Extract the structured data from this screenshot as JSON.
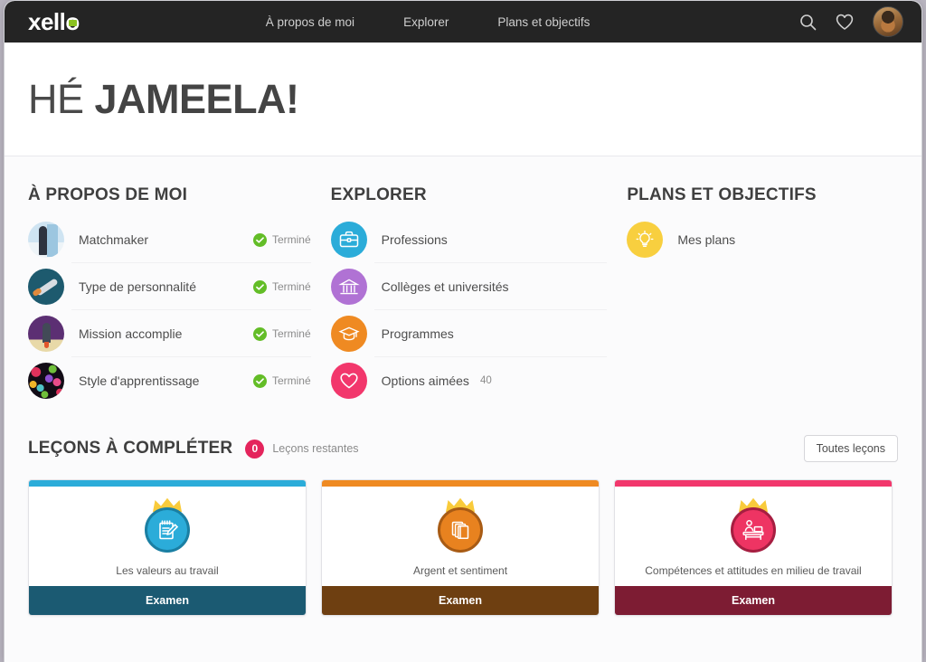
{
  "nav": {
    "logo_text": "xello",
    "links": [
      {
        "label": "À propos de moi"
      },
      {
        "label": "Explorer"
      },
      {
        "label": "Plans et objectifs"
      }
    ],
    "search_icon": "search-icon",
    "favourites_icon": "heart-icon",
    "avatar_icon": "user-avatar"
  },
  "hero": {
    "greeting": "HÉ",
    "name": "JAMEELA!"
  },
  "columns": [
    {
      "title": "À PROPOS DE MOI",
      "rows": [
        {
          "label": "Matchmaker",
          "status": "Terminé",
          "thumb": "rocket-launch-tower-icon"
        },
        {
          "label": "Type de personnalité",
          "status": "Terminé",
          "thumb": "rocket-flying-icon"
        },
        {
          "label": "Mission accomplie",
          "status": "Terminé",
          "thumb": "rocket-landed-icon"
        },
        {
          "label": "Style d'apprentissage",
          "status": "Terminé",
          "thumb": "confetti-icon"
        }
      ]
    },
    {
      "title": "EXPLORER",
      "rows": [
        {
          "label": "Professions",
          "count": "",
          "icon": "briefcase-icon",
          "color": "#2bacd9"
        },
        {
          "label": "Collèges et universités",
          "count": "",
          "icon": "bank-columns-icon",
          "color": "#b072d4"
        },
        {
          "label": "Programmes",
          "count": "",
          "icon": "graduation-cap-icon",
          "color": "#ef8a22"
        },
        {
          "label": "Options aimées",
          "count": "40",
          "icon": "heart-icon",
          "color": "#f2376c"
        }
      ]
    },
    {
      "title": "PLANS ET OBJECTIFS",
      "rows": [
        {
          "label": "Mes plans",
          "count": "",
          "icon": "lightbulb-icon",
          "color": "#f8cf3f"
        }
      ]
    }
  ],
  "lessons": {
    "title": "LEÇONS À COMPLÉTER",
    "badge_count": "0",
    "remaining_label": "Leçons restantes",
    "all_lessons_button": "Toutes leçons",
    "cards": [
      {
        "title": "Les valeurs au travail",
        "footer_label": "Examen",
        "icon": "notepad-pencil-icon",
        "top_color": "#2bacd9",
        "disc_color": "#2bacd9",
        "ring_color": "#1a7fa3",
        "foot_color": "#1b5a72"
      },
      {
        "title": "Argent et sentiment",
        "footer_label": "Examen",
        "icon": "books-icon",
        "top_color": "#ef8a22",
        "disc_color": "#e8821f",
        "ring_color": "#a85b14",
        "foot_color": "#6e3f11"
      },
      {
        "title": "Compétences et attitudes en milieu de travail",
        "footer_label": "Examen",
        "icon": "person-at-desk-icon",
        "top_color": "#f2376c",
        "disc_color": "#ee3463",
        "ring_color": "#a61e41",
        "foot_color": "#7d1c33"
      }
    ]
  },
  "colors": {
    "nav_background": "#242424",
    "logo_accent": "#8bc220",
    "status_green": "#63bd27",
    "badge_pink": "#e4245c",
    "text_dark": "#4a4a4a",
    "text_muted": "#8b8b8b",
    "page_background": "#fbfbfc"
  }
}
